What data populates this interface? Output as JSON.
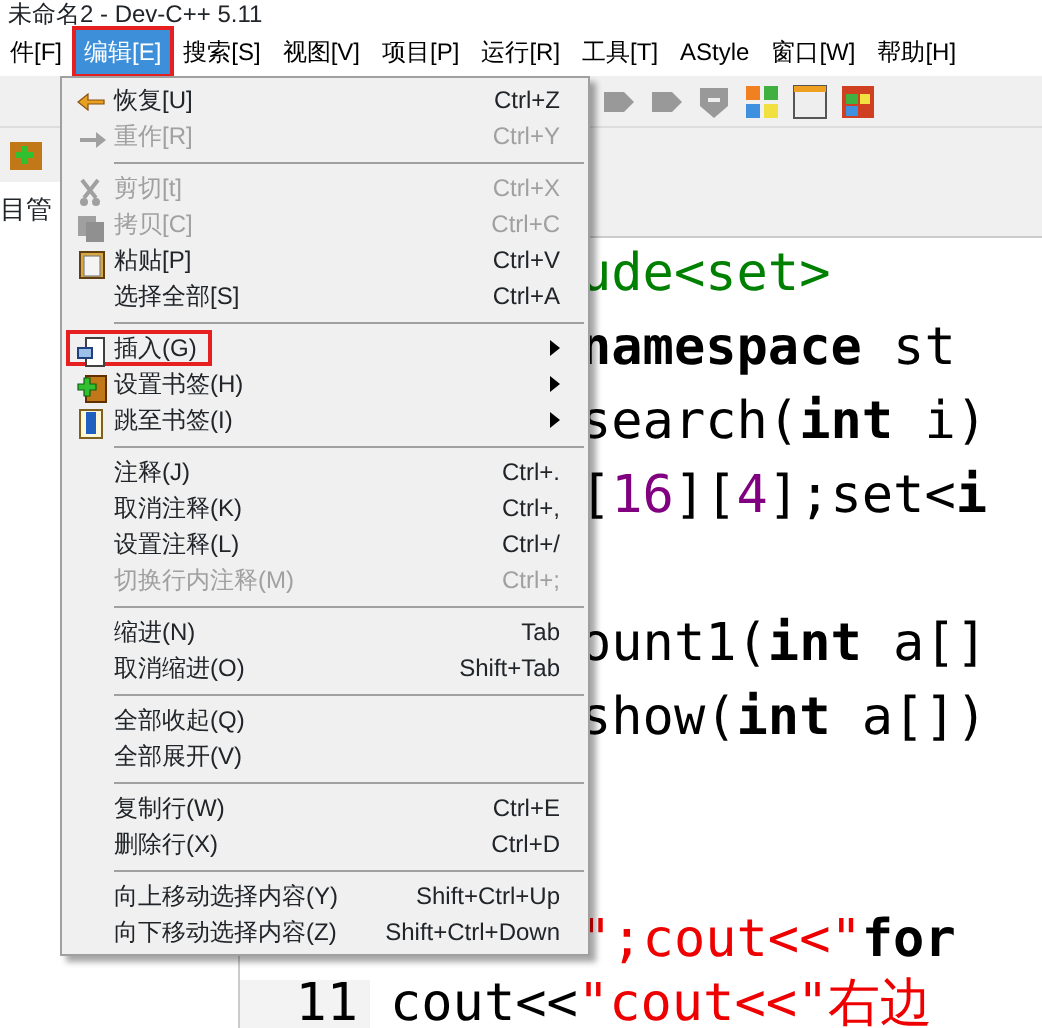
{
  "window": {
    "title": "未命名2 - Dev-C++ 5.11"
  },
  "menubar": [
    {
      "label": "件[F]",
      "selected": false,
      "highlighted": false
    },
    {
      "label": "编辑[E]",
      "selected": true,
      "highlighted": true
    },
    {
      "label": "搜索[S]",
      "selected": false,
      "highlighted": false
    },
    {
      "label": "视图[V]",
      "selected": false,
      "highlighted": false
    },
    {
      "label": "项目[P]",
      "selected": false,
      "highlighted": false
    },
    {
      "label": "运行[R]",
      "selected": false,
      "highlighted": false
    },
    {
      "label": "工具[T]",
      "selected": false,
      "highlighted": false
    },
    {
      "label": "AStyle",
      "selected": false,
      "highlighted": false
    },
    {
      "label": "窗口[W]",
      "selected": false,
      "highlighted": false
    },
    {
      "label": "帮助[H]",
      "selected": false,
      "highlighted": false
    }
  ],
  "left_panel": {
    "tab": "目管"
  },
  "menu": [
    {
      "kind": "item",
      "label": "恢复[U]",
      "shortcut": "Ctrl+Z",
      "disabled": false,
      "submenu": false,
      "highlighted": false
    },
    {
      "kind": "item",
      "label": "重作[R]",
      "shortcut": "Ctrl+Y",
      "disabled": true,
      "submenu": false,
      "highlighted": false
    },
    {
      "kind": "separator"
    },
    {
      "kind": "item",
      "label": "剪切[t]",
      "shortcut": "Ctrl+X",
      "disabled": true,
      "submenu": false,
      "highlighted": false
    },
    {
      "kind": "item",
      "label": "拷贝[C]",
      "shortcut": "Ctrl+C",
      "disabled": true,
      "submenu": false,
      "highlighted": false
    },
    {
      "kind": "item",
      "label": "粘贴[P]",
      "shortcut": "Ctrl+V",
      "disabled": false,
      "submenu": false,
      "highlighted": false
    },
    {
      "kind": "item",
      "label": "选择全部[S]",
      "shortcut": "Ctrl+A",
      "disabled": false,
      "submenu": false,
      "highlighted": false
    },
    {
      "kind": "separator"
    },
    {
      "kind": "item",
      "label": "插入(G)",
      "disabled": false,
      "submenu": true,
      "highlighted": true
    },
    {
      "kind": "item",
      "label": "设置书签(H)",
      "disabled": false,
      "submenu": true,
      "highlighted": false
    },
    {
      "kind": "item",
      "label": "跳至书签(I)",
      "disabled": false,
      "submenu": true,
      "highlighted": false
    },
    {
      "kind": "separator"
    },
    {
      "kind": "item",
      "label": "注释(J)",
      "shortcut": "Ctrl+.",
      "disabled": false,
      "submenu": false,
      "highlighted": false
    },
    {
      "kind": "item",
      "label": "取消注释(K)",
      "shortcut": "Ctrl+,",
      "disabled": false,
      "submenu": false,
      "highlighted": false
    },
    {
      "kind": "item",
      "label": "设置注释(L)",
      "shortcut": "Ctrl+/",
      "disabled": false,
      "submenu": false,
      "highlighted": false
    },
    {
      "kind": "item",
      "label": "切换行内注释(M)",
      "shortcut": "Ctrl+;",
      "disabled": true,
      "submenu": false,
      "highlighted": false
    },
    {
      "kind": "separator"
    },
    {
      "kind": "item",
      "label": "缩进(N)",
      "shortcut": "Tab",
      "disabled": false,
      "submenu": false,
      "highlighted": false
    },
    {
      "kind": "item",
      "label": "取消缩进(O)",
      "shortcut": "Shift+Tab",
      "disabled": false,
      "submenu": false,
      "highlighted": false
    },
    {
      "kind": "separator"
    },
    {
      "kind": "item",
      "label": "全部收起(Q)",
      "disabled": false,
      "submenu": false,
      "highlighted": false
    },
    {
      "kind": "item",
      "label": "全部展开(V)",
      "disabled": false,
      "submenu": false,
      "highlighted": false
    },
    {
      "kind": "separator"
    },
    {
      "kind": "item",
      "label": "复制行(W)",
      "shortcut": "Ctrl+E",
      "disabled": false,
      "submenu": false,
      "highlighted": false
    },
    {
      "kind": "item",
      "label": "删除行(X)",
      "shortcut": "Ctrl+D",
      "disabled": false,
      "submenu": false,
      "highlighted": false
    },
    {
      "kind": "separator"
    },
    {
      "kind": "item",
      "label": "向上移动选择内容(Y)",
      "shortcut": "Shift+Ctrl+Up",
      "disabled": false,
      "submenu": false,
      "highlighted": false
    },
    {
      "kind": "item",
      "label": "向下移动选择内容(Z)",
      "shortcut": "Shift+Ctrl+Down",
      "disabled": false,
      "submenu": false,
      "highlighted": false
    }
  ],
  "editor": {
    "lines": [
      {
        "tokens": [
          {
            "kind": "preproc",
            "text": "ude<set>"
          }
        ]
      },
      {
        "tokens": [
          {
            "kind": "keyword",
            "text": "namespace"
          },
          {
            "kind": "plain",
            "text": " st"
          }
        ]
      },
      {
        "tokens": [
          {
            "kind": "plain",
            "text": "search("
          },
          {
            "kind": "keyword",
            "text": "int"
          },
          {
            "kind": "plain",
            "text": " i)"
          }
        ]
      },
      {
        "tokens": [
          {
            "kind": "plain",
            "text": "["
          },
          {
            "kind": "number",
            "text": "16"
          },
          {
            "kind": "plain",
            "text": "]["
          },
          {
            "kind": "number",
            "text": "4"
          },
          {
            "kind": "plain",
            "text": "];set<"
          },
          {
            "kind": "keyword",
            "text": "i"
          }
        ]
      },
      {
        "kind": "blank"
      },
      {
        "tokens": [
          {
            "kind": "plain",
            "text": "ount1("
          },
          {
            "kind": "keyword",
            "text": "int"
          },
          {
            "kind": "plain",
            "text": " a[]"
          }
        ]
      },
      {
        "tokens": [
          {
            "kind": "plain",
            "text": "show("
          },
          {
            "kind": "keyword",
            "text": "int"
          },
          {
            "kind": "plain",
            "text": " a[])"
          }
        ]
      },
      {
        "kind": "blank"
      },
      {
        "kind": "blank"
      },
      {
        "tokens": [
          {
            "kind": "string",
            "text": "\";cout<<\""
          },
          {
            "kind": "keyword",
            "text": "for"
          }
        ]
      },
      {
        "number": "11",
        "tokens": [
          {
            "kind": "plain",
            "text": "cout<<"
          },
          {
            "kind": "string",
            "text": "\"cout<<\"右边"
          }
        ]
      }
    ]
  }
}
